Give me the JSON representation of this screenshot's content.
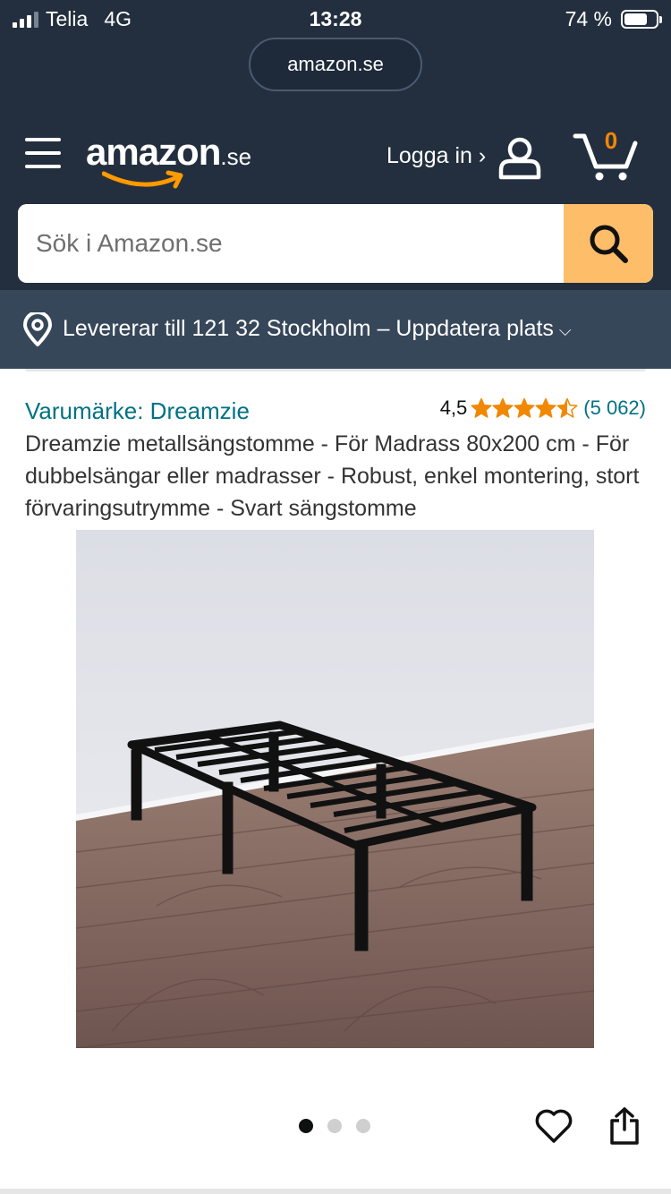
{
  "status_bar": {
    "carrier": "Telia",
    "network": "4G",
    "time": "13:28",
    "battery": "74 %",
    "battery_level": 0.74
  },
  "browser": {
    "url": "amazon.se"
  },
  "header": {
    "logo_word": "amazon",
    "logo_tld": ".se",
    "sign_in": "Logga in ›",
    "cart_count": "0",
    "colors": {
      "header_bg": "#232f3e",
      "delivery_bg": "#37475a",
      "search_button": "#febd69",
      "cart_count": "#f08804",
      "logo_smile": "#ff9900"
    }
  },
  "search": {
    "placeholder": "Sök i Amazon.se",
    "value": ""
  },
  "delivery": {
    "text": "Levererar till 121 32 Stockholm – Uppdatera plats"
  },
  "product": {
    "brand": "Varumärke: Dreamzie",
    "rating_value": "4,5",
    "rating_stars": 4.5,
    "rating_count": "(5 062)",
    "title": "Dreamzie metallsängstomme - För Madrass 80x200 cm - För dubbelsängar eller madrasser - Robust, enkel montering, stort förvaringsutrymme - Svart sängstomme",
    "image_alt": "black metal bed frame on wooden floor",
    "image_count": 3,
    "active_image": 1
  },
  "icons": {
    "menu": "hamburger-icon",
    "user": "user-icon",
    "cart": "cart-icon",
    "search": "search-icon",
    "location": "location-pin-icon",
    "wishlist": "heart-icon",
    "share": "share-icon"
  }
}
